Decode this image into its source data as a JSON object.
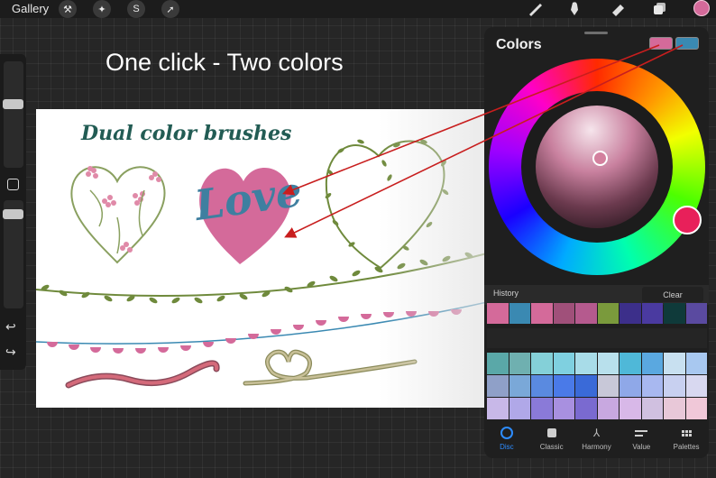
{
  "toolbar": {
    "gallery_label": "Gallery",
    "left_icons": [
      "wrench-icon",
      "magic-wand-icon",
      "selection-s-icon",
      "transform-arrow-icon"
    ],
    "right_icons": [
      "brush-icon",
      "smudge-icon",
      "eraser-icon",
      "layers-icon"
    ],
    "active_color": "#d46a9a"
  },
  "sidebar": {
    "icons": [
      "brush-size-slider",
      "modify-square-icon",
      "opacity-slider",
      "undo-icon",
      "redo-icon"
    ],
    "undo_glyph": "↩",
    "redo_glyph": "↪"
  },
  "canvas": {
    "headline": "One click - Two colors",
    "art_title": "Dual color brushes",
    "love_text": "Love"
  },
  "colors_panel": {
    "title": "Colors",
    "primary_swatch": "#d46a9a",
    "secondary_swatch": "#3a89b2",
    "history_label": "History",
    "clear_label": "Clear",
    "history": [
      "#d46a9a",
      "#3a89b2",
      "#d46a9a",
      "#a0507a",
      "#b55a8e",
      "#7a9a3c",
      "#3c2f8a",
      "#4a3aa0",
      "#0f3a3a",
      "#5a4aa0"
    ],
    "palette": [
      "#5aa8a8",
      "#6fb0b0",
      "#84d0d8",
      "#7fd0e0",
      "#a8dce8",
      "#b8e0ec",
      "#4fb8d8",
      "#5aa8e0",
      "#c8e0f0",
      "#a8c8f0",
      "#8fa0c8",
      "#7aa8d8",
      "#5a8ae0",
      "#4a7ae8",
      "#3a6ad8",
      "#c8c8d8",
      "#8fa8e8",
      "#a8b8f0",
      "#c8d0f0",
      "#d8d8f0",
      "#c8b8e8",
      "#b0a8e8",
      "#8a7ad8",
      "#a890e0",
      "#7a6ad0",
      "#c8a8e0",
      "#d8b8e8",
      "#d0c0e0",
      "#e8c8d8",
      "#f0c8d8"
    ],
    "tabs": [
      {
        "label": "Disc",
        "active": true
      },
      {
        "label": "Classic",
        "active": false
      },
      {
        "label": "Harmony",
        "active": false
      },
      {
        "label": "Value",
        "active": false
      },
      {
        "label": "Palettes",
        "active": false
      }
    ]
  }
}
